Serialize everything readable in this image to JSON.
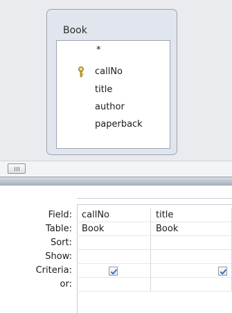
{
  "table_box": {
    "title": "Book",
    "fields": [
      "*",
      "callNo",
      "title",
      "author",
      "paperback"
    ],
    "primary_key_field": "callNo"
  },
  "grid": {
    "row_labels": [
      "Field:",
      "Table:",
      "Sort:",
      "Show:",
      "Criteria:",
      "or:"
    ],
    "columns": [
      {
        "field": "callNo",
        "table": "Book",
        "sort": "",
        "show": true,
        "criteria": "",
        "or": ""
      },
      {
        "field": "title",
        "table": "Book",
        "sort": "",
        "show": true,
        "criteria": "",
        "or": ""
      }
    ]
  },
  "icons": {
    "primary_key": "key-icon",
    "scroll_thumb": "scroll-grip-icon",
    "checkbox": "checkmark-icon"
  },
  "colors": {
    "upper_background": "#e9ebee",
    "table_box_fill": "#e1e6ee",
    "checkbox_check": "#2f63b7",
    "splitter": "#a4adb8"
  }
}
